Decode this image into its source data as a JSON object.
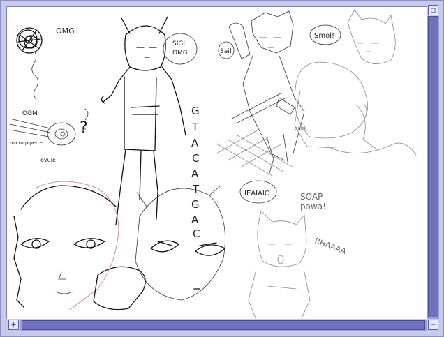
{
  "scrollbar": {
    "top_button_glyph": "◻",
    "plus_glyph": "+",
    "minus_glyph": "−"
  },
  "canvas_text": {
    "omg_top": "OMG",
    "ogm": "OGM",
    "micro_pipette": "micro pipette",
    "ovule": "ovule",
    "question": "?",
    "sigi_omg_line1": "SIGI",
    "sigi_omg_line2": "OMG",
    "seq": [
      "G",
      "T",
      "A",
      "C",
      "A",
      "T",
      "G",
      "A",
      "C"
    ],
    "sai": "Sai!",
    "smol": "Smol!",
    "quirk": "quirk",
    "ieaiaio": "IEAIAIO",
    "soap_line1": "SOAP",
    "soap_line2": "pawa!",
    "rhaaa": "RHAAAA"
  },
  "colors": {
    "chrome": "#c8cbe8",
    "scroll_track": "#9ca0d4",
    "scroll_thumb": "#6f73bd",
    "canvas": "#ffffff"
  }
}
